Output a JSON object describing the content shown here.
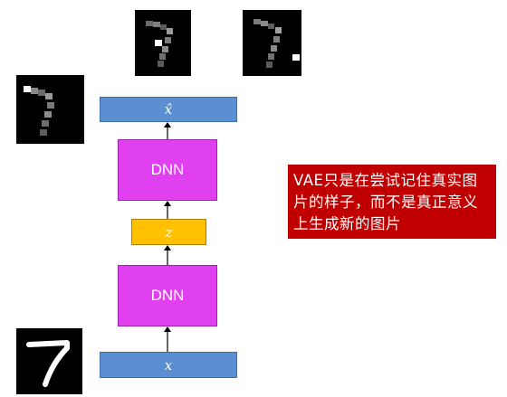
{
  "diagram": {
    "output_label": "x̂",
    "latent_label": "z",
    "input_label": "x",
    "decoder_label": "DNN",
    "encoder_label": "DNN"
  },
  "note": {
    "text": "VAE只是在尝试记住真实图片的样子，而不是真正意义上生成新的图片"
  },
  "images": {
    "generated_1": "pixelated-digit-7-sample",
    "generated_2": "pixelated-digit-7-sample",
    "reconstructed": "pixelated-digit-7-sample",
    "input": "handwritten-digit-7"
  },
  "colors": {
    "bar": "#5b8fd1",
    "dnn": "#e040f0",
    "latent": "#ffc000",
    "note_bg": "#c00000"
  }
}
